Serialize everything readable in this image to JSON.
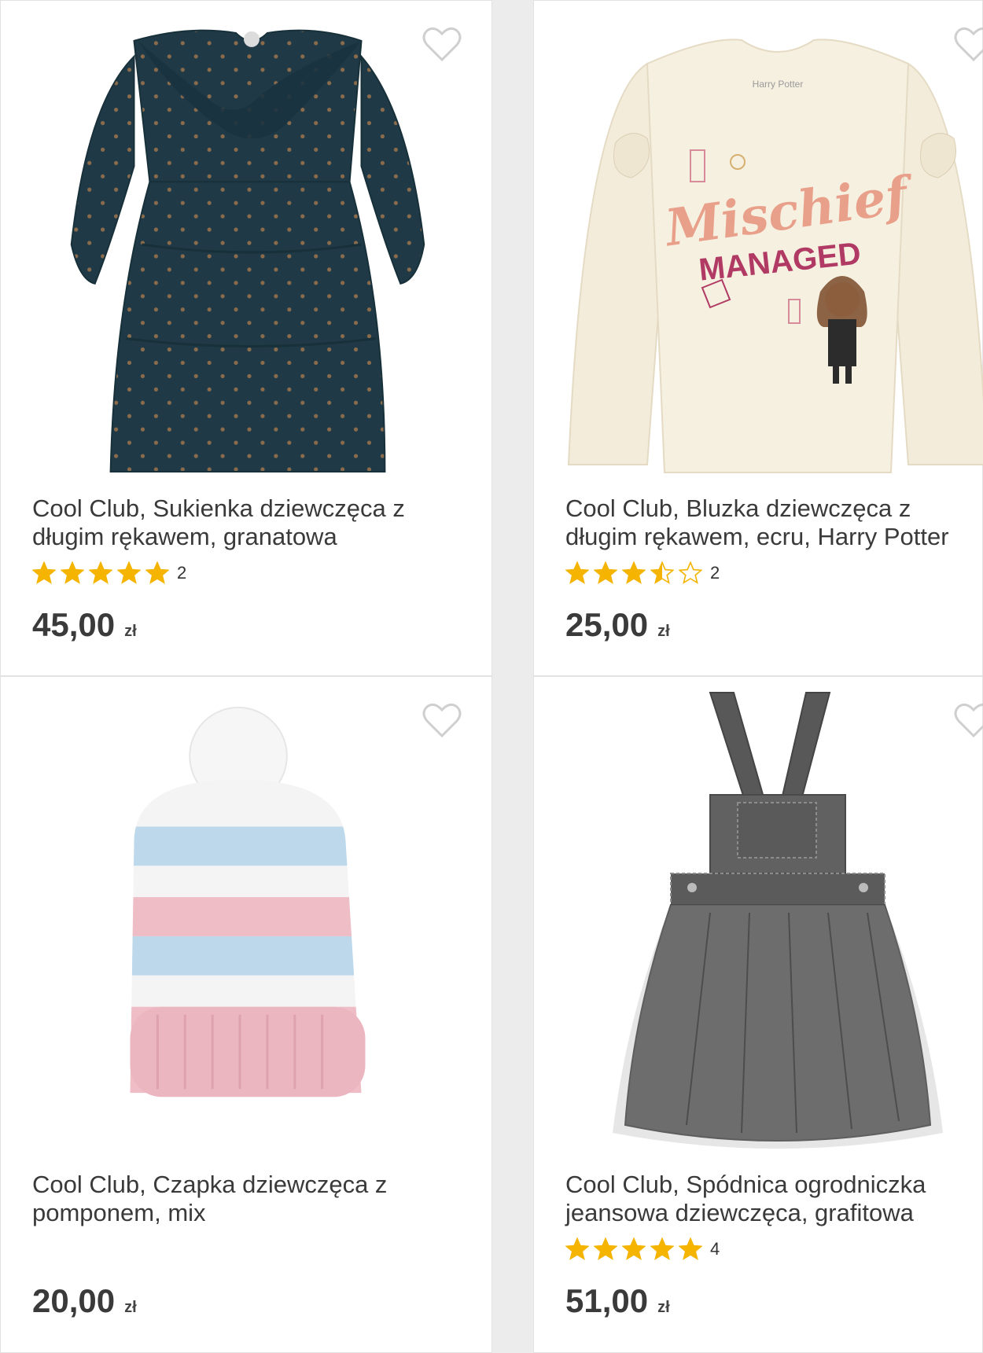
{
  "colors": {
    "star": "#f4b400",
    "heart_stroke": "#cfcfcf",
    "text": "#3a3a3a"
  },
  "products": [
    {
      "title_line1": "Cool Club, Sukienka dziewczęca z",
      "title_line2": "długim rękawem, granatowa",
      "rating": 5,
      "review_count": "2",
      "price": "45,00",
      "currency": "zł",
      "image": "navy-dress"
    },
    {
      "title_line1": "Cool Club, Bluzka dziewczęca z",
      "title_line2": "długim rękawem, ecru, Harry Potter",
      "rating": 3.5,
      "review_count": "2",
      "price": "25,00",
      "currency": "zł",
      "image": "ecru-shirt",
      "print_line1": "Mischief",
      "print_line2": "MANAGED"
    },
    {
      "title_line1": "Cool Club, Czapka dziewczęca z",
      "title_line2": "pomponem, mix",
      "rating": null,
      "review_count": "",
      "price": "20,00",
      "currency": "zł",
      "image": "striped-hat"
    },
    {
      "title_line1": "Cool Club, Spódnica ogrodniczka",
      "title_line2": "jeansowa dziewczęca, grafitowa",
      "rating": 5,
      "review_count": "4",
      "price": "51,00",
      "currency": "zł",
      "image": "grey-pinafore"
    }
  ]
}
